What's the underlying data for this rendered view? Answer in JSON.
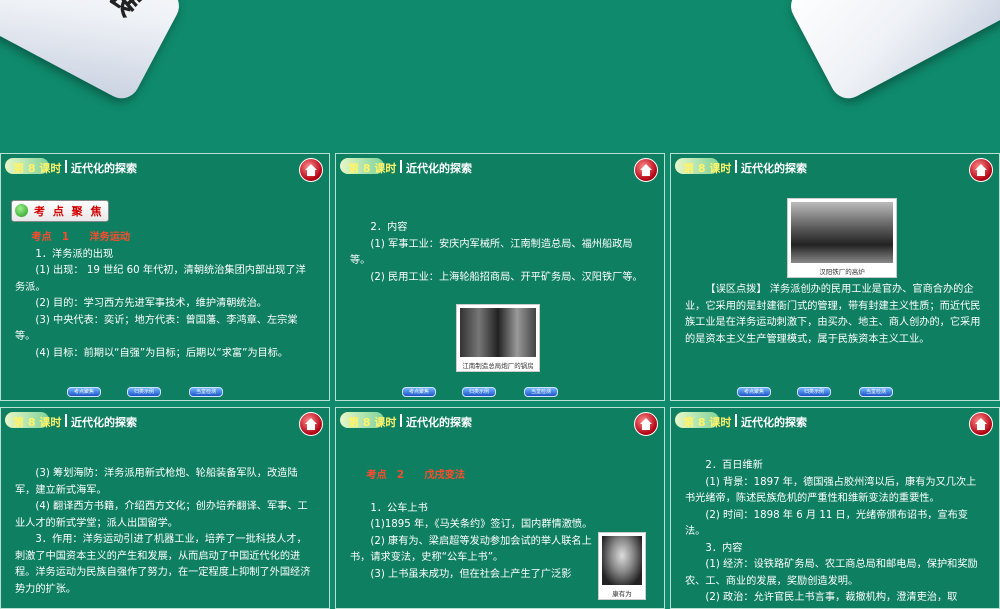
{
  "banner": {
    "left_badge_text": "拓展"
  },
  "panel_header": {
    "lesson": "第 8 课时",
    "title": "近代化的探索"
  },
  "nav": [
    "考点聚焦",
    "归类示例",
    "当堂检测"
  ],
  "panels": [
    {
      "badge": "考 点 聚 焦",
      "lines": [
        {
          "t": "考点　1　　洋务运动",
          "style": "heading"
        },
        {
          "t": "1．洋务派的出现",
          "style": "indent"
        },
        {
          "t": "(1) 出现： 19 世纪 60 年代初，清朝统治集团内部出现了洋务派。",
          "style": "indent"
        },
        {
          "t": "(2) 目的：学习西方先进军事技术，维护清朝统治。",
          "style": "indent"
        },
        {
          "t": "(3) 中央代表：奕䜣；地方代表：曾国藩、李鸿章、左宗棠等。",
          "style": "indent"
        },
        {
          "t": "(4) 目标：前期以“自强”为目标；后期以“求富”为目标。",
          "style": "indent"
        }
      ]
    },
    {
      "lines": [
        {
          "t": "2．内容",
          "style": "indent"
        },
        {
          "t": "(1) 军事工业：安庆内军械所、江南制造总局、福州船政局等。",
          "style": "indent"
        },
        {
          "t": "(2) 民用工业：上海轮船招商局、开平矿务局、汉阳铁厂等。",
          "style": "indent"
        }
      ],
      "photo_caption": "江南制造总局炮厂的锅房"
    },
    {
      "photo_caption": "汉阳铁厂的高炉",
      "lines": [
        {
          "t": "【误区点拨】 洋务派创办的民用工业是官办、官商合办的企业，它采用的是封建衙门式的管理，带有封建主义性质；而近代民族工业是在洋务运动刺激下，由买办、地主、商人创办的，它采用的是资本主义生产管理模式，属于民族资本主义工业。",
          "style": "indent"
        }
      ]
    },
    {
      "lines": [
        {
          "t": "(3) 筹划海防：洋务派用新式枪炮、轮船装备军队，改造陆军，建立新式海军。",
          "style": "indent"
        },
        {
          "t": "(4) 翻译西方书籍，介绍西方文化；创办培养翻译、军事、工业人才的新式学堂；派人出国留学。",
          "style": "indent"
        },
        {
          "t": "3．作用：洋务运动引进了机器工业，培养了一批科技人才，刺激了中国资本主义的产生和发展，从而启动了中国近代化的进程。洋务运动为民族自强作了努力，在一定程度上抑制了外国经济势力的扩张。",
          "style": "indent"
        }
      ]
    },
    {
      "lines": [
        {
          "t": "考点　2　　戊戌变法",
          "style": "heading"
        },
        {
          "t": "1．公车上书",
          "style": "indent"
        },
        {
          "t": "(1)1895 年，《马关条约》签订，国内群情激愤。",
          "style": "indent"
        },
        {
          "t": "(2) 康有为、梁启超等发动参加会试的举人联名上书，请求变法，史称“公车上书”。",
          "style": "indent"
        },
        {
          "t": "(3) 上书虽未成功，但在社会上产生了广泛影",
          "style": "indent"
        }
      ],
      "photo_caption": "康有为"
    },
    {
      "lines": [
        {
          "t": "2．百日维新",
          "style": "indent"
        },
        {
          "t": "(1) 背景：1897 年，德国强占胶州湾以后，康有为又几次上书光绪帝，陈述民族危机的严重性和维新变法的重要性。",
          "style": "indent"
        },
        {
          "t": "(2) 时间：1898 年 6 月 11 日，光绪帝颁布诏书，宣布变法。",
          "style": "indent"
        },
        {
          "t": "3．内容",
          "style": "indent"
        },
        {
          "t": "(1) 经济：设铁路矿务局、农工商总局和邮电局，保护和奖励农、工、商业的发展，奖励创造发明。",
          "style": "indent"
        },
        {
          "t": "(2) 政治：允许官民上书言事，裁撤机构，澄清吏治，取",
          "style": "indent"
        }
      ]
    }
  ]
}
